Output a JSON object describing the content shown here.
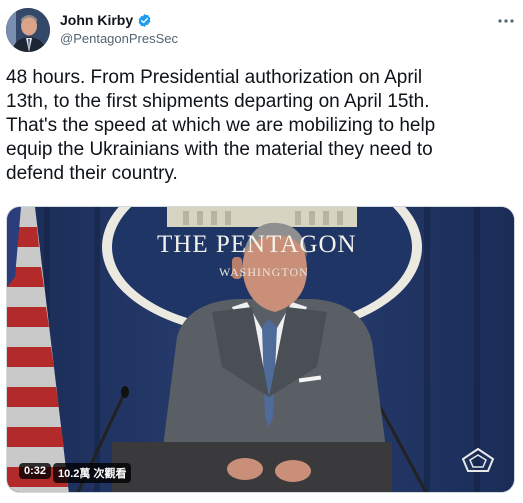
{
  "author": {
    "name": "John Kirby",
    "handle": "@PentagonPresSec",
    "verified_icon": "verified-badge-icon",
    "verified_color": "#1d9bf0"
  },
  "menu_icon": "more-dots-icon",
  "tweet": {
    "text": "48 hours. From Presidential authorization on April\n13th, to the first shipments departing on April 15th.\nThat's the speed at which we are mobilizing to help\nequip the Ukrainians with the material they need to\ndefend their country."
  },
  "video": {
    "backdrop_text": "THE PENTAGON",
    "backdrop_sub": "WASHINGTON",
    "duration": "0:32",
    "views": "10.2萬 次觀看",
    "watermark_icon": "pentagon-logo-icon"
  }
}
